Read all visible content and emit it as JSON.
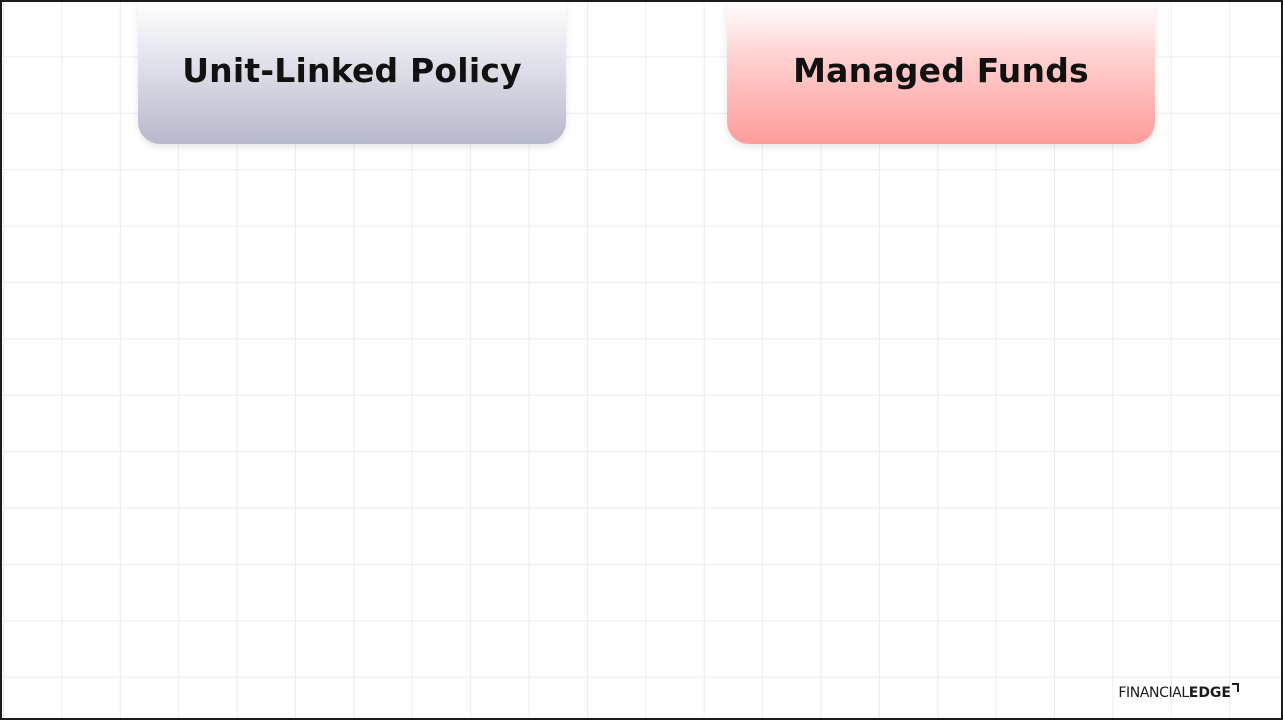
{
  "headers": {
    "left": {
      "label": "Unit-Linked Policy",
      "color": "#b6b8cc"
    },
    "right": {
      "label": "Managed Funds",
      "color": "#ff9c9a"
    }
  },
  "brand": {
    "light_text": "FINANCIAL",
    "bold_text": "EDGE",
    "icon": "corner-bracket-icon"
  },
  "colors": {
    "border": "#1b1b1b",
    "grid": "#ececec",
    "background": "#ffffff"
  }
}
